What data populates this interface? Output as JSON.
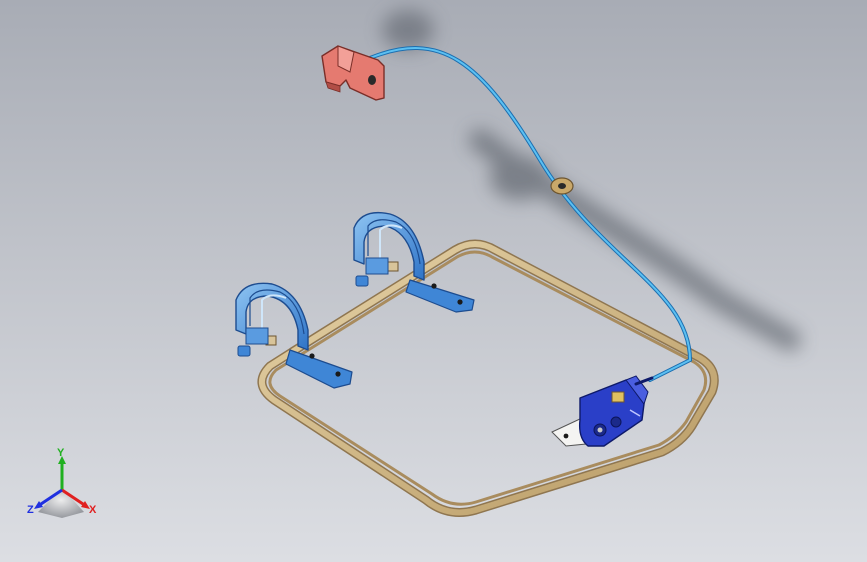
{
  "viewport": {
    "background_top": "#a8acb5",
    "background_bottom": "#dcdee3"
  },
  "model": {
    "loop_color": "#d8c49a",
    "cable_color": "#3aa0e0",
    "bracket_color": "#3b82d6",
    "latch_color": "#e0716a",
    "actuator_color": "#2a3fc8"
  },
  "triad": {
    "x_label": "X",
    "y_label": "Y",
    "z_label": "Z",
    "x_color": "#e02020",
    "y_color": "#20b020",
    "z_color": "#2030e0"
  }
}
